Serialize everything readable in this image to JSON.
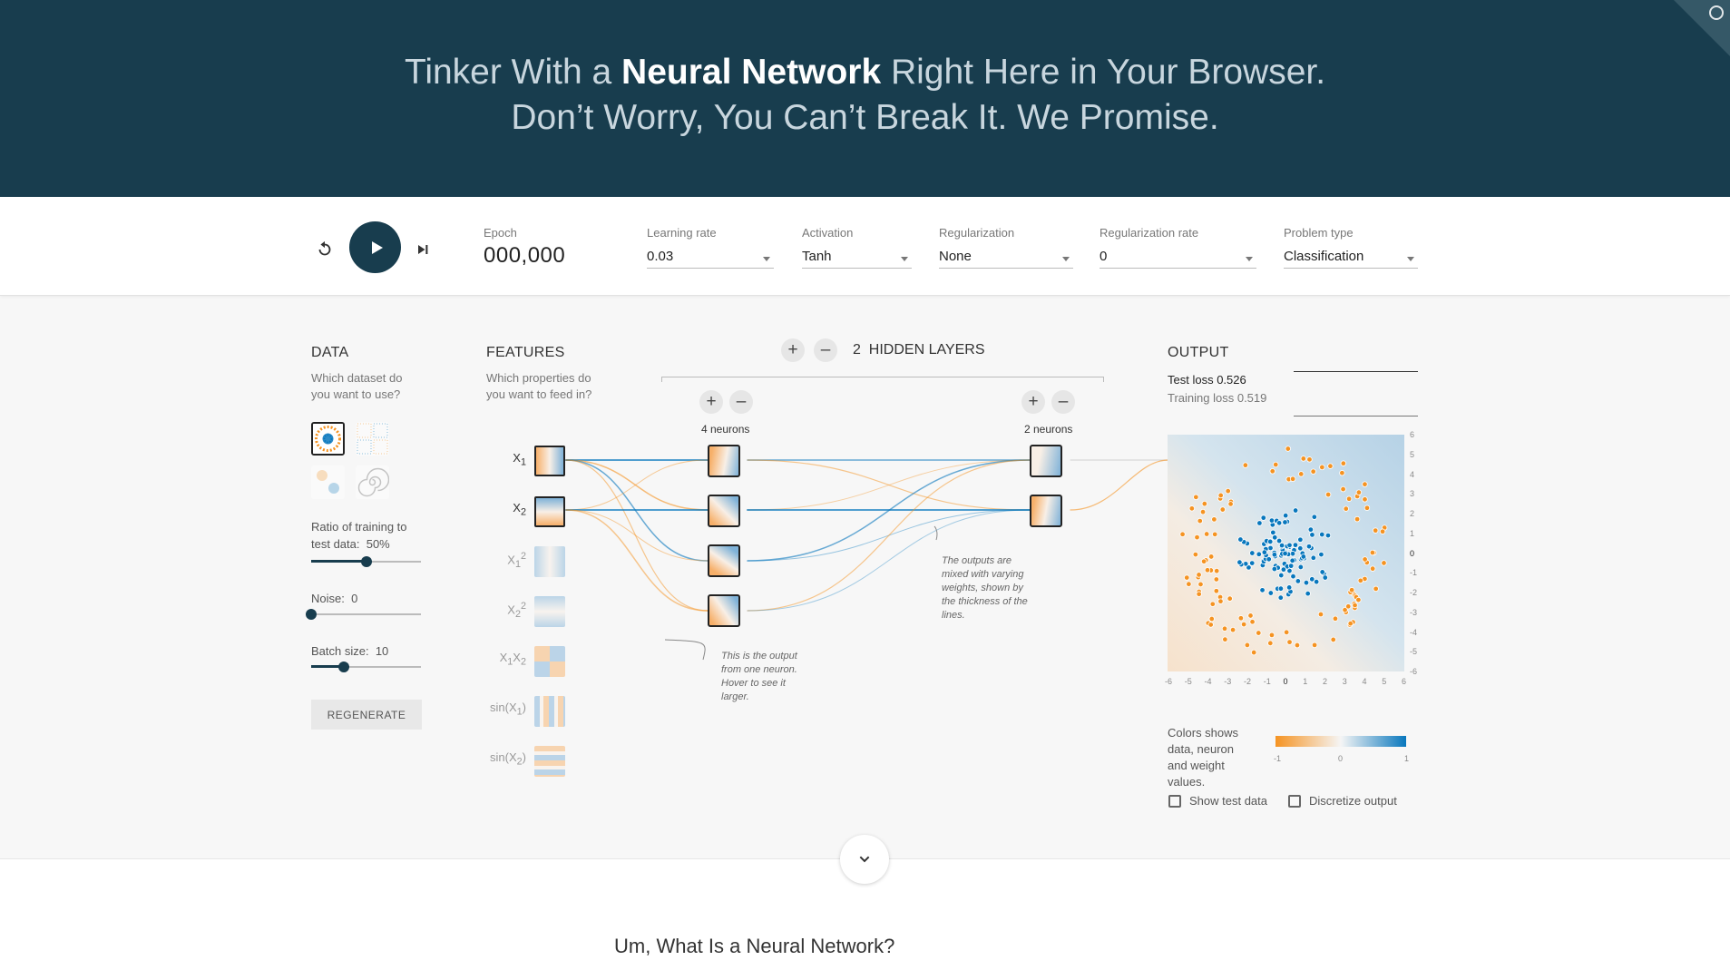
{
  "header": {
    "line1_pre": "Tinker With a ",
    "line1_bold": "Neural Network",
    "line1_post": " Right Here in Your Browser.",
    "line2": "Don’t Worry, You Can’t Break It. We Promise."
  },
  "controls": {
    "epoch_label": "Epoch",
    "epoch_value": "000,000",
    "learning_rate_label": "Learning rate",
    "learning_rate_value": "0.03",
    "activation_label": "Activation",
    "activation_value": "Tanh",
    "regularization_label": "Regularization",
    "regularization_value": "None",
    "regularization_rate_label": "Regularization rate",
    "regularization_rate_value": "0",
    "problem_type_label": "Problem type",
    "problem_type_value": "Classification"
  },
  "data_panel": {
    "title": "DATA",
    "subtitle": "Which dataset do you want to use?",
    "ratio_label": "Ratio of training to test data:",
    "ratio_value": "50%",
    "ratio_fraction": 0.5,
    "noise_label": "Noise:",
    "noise_value": "0",
    "noise_fraction": 0,
    "batch_label": "Batch size:",
    "batch_value": "10",
    "batch_fraction": 0.3,
    "regenerate_label": "REGENERATE"
  },
  "features_panel": {
    "title": "FEATURES",
    "subtitle": "Which properties do you want to feed in?",
    "features": [
      "X1",
      "X2",
      "X1²",
      "X2²",
      "X1X2",
      "sin(X1)",
      "sin(X2)"
    ]
  },
  "network": {
    "hidden_layers_count": "2",
    "hidden_layers_label": "HIDDEN LAYERS",
    "layer1_neurons": "4 neurons",
    "layer2_neurons": "2 neurons",
    "note_neuron": "This is the output from one neuron. Hover to see it larger.",
    "note_weights": "The outputs are mixed with varying weights, shown by the thickness of the lines."
  },
  "output_panel": {
    "title": "OUTPUT",
    "test_loss_label": "Test loss",
    "test_loss_value": "0.526",
    "training_loss_label": "Training loss",
    "training_loss_value": "0.519",
    "x_ticks": [
      "-6",
      "-5",
      "-4",
      "-3",
      "-2",
      "-1",
      "0",
      "1",
      "2",
      "3",
      "4",
      "5",
      "6"
    ],
    "y_ticks": [
      "6",
      "5",
      "4",
      "3",
      "2",
      "1",
      "0",
      "-1",
      "-2",
      "-3",
      "-4",
      "-5",
      "-6"
    ],
    "legend_text": "Colors shows data, neuron and weight values.",
    "legend_ticks": [
      "-1",
      "0",
      "1"
    ],
    "show_test_label": "Show test data",
    "discretize_label": "Discretize output"
  },
  "bottom": {
    "heading": "Um, What Is a Neural Network?"
  },
  "colors": {
    "header_bg": "#183d4e",
    "orange": "#f59322",
    "blue": "#0877bd"
  }
}
